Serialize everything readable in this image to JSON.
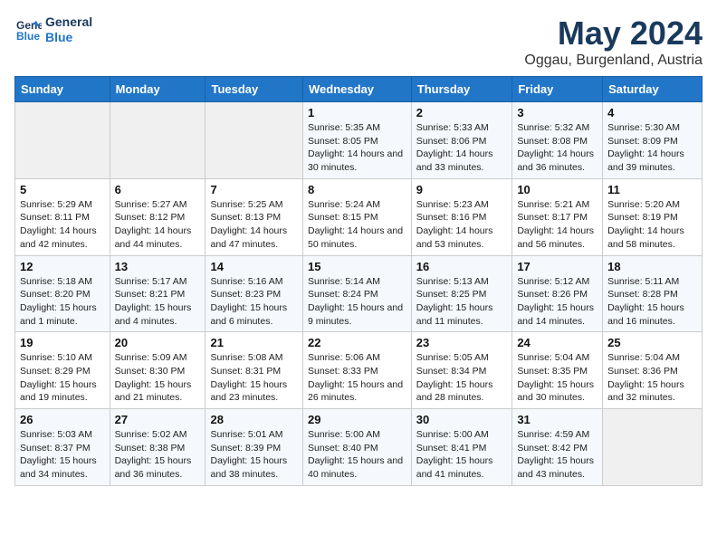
{
  "header": {
    "logo_line1": "General",
    "logo_line2": "Blue",
    "title": "May 2024",
    "subtitle": "Oggau, Burgenland, Austria"
  },
  "weekdays": [
    "Sunday",
    "Monday",
    "Tuesday",
    "Wednesday",
    "Thursday",
    "Friday",
    "Saturday"
  ],
  "weeks": [
    [
      {
        "day": "",
        "sunrise": "",
        "sunset": "",
        "daylight": ""
      },
      {
        "day": "",
        "sunrise": "",
        "sunset": "",
        "daylight": ""
      },
      {
        "day": "",
        "sunrise": "",
        "sunset": "",
        "daylight": ""
      },
      {
        "day": "1",
        "sunrise": "Sunrise: 5:35 AM",
        "sunset": "Sunset: 8:05 PM",
        "daylight": "Daylight: 14 hours and 30 minutes."
      },
      {
        "day": "2",
        "sunrise": "Sunrise: 5:33 AM",
        "sunset": "Sunset: 8:06 PM",
        "daylight": "Daylight: 14 hours and 33 minutes."
      },
      {
        "day": "3",
        "sunrise": "Sunrise: 5:32 AM",
        "sunset": "Sunset: 8:08 PM",
        "daylight": "Daylight: 14 hours and 36 minutes."
      },
      {
        "day": "4",
        "sunrise": "Sunrise: 5:30 AM",
        "sunset": "Sunset: 8:09 PM",
        "daylight": "Daylight: 14 hours and 39 minutes."
      }
    ],
    [
      {
        "day": "5",
        "sunrise": "Sunrise: 5:29 AM",
        "sunset": "Sunset: 8:11 PM",
        "daylight": "Daylight: 14 hours and 42 minutes."
      },
      {
        "day": "6",
        "sunrise": "Sunrise: 5:27 AM",
        "sunset": "Sunset: 8:12 PM",
        "daylight": "Daylight: 14 hours and 44 minutes."
      },
      {
        "day": "7",
        "sunrise": "Sunrise: 5:25 AM",
        "sunset": "Sunset: 8:13 PM",
        "daylight": "Daylight: 14 hours and 47 minutes."
      },
      {
        "day": "8",
        "sunrise": "Sunrise: 5:24 AM",
        "sunset": "Sunset: 8:15 PM",
        "daylight": "Daylight: 14 hours and 50 minutes."
      },
      {
        "day": "9",
        "sunrise": "Sunrise: 5:23 AM",
        "sunset": "Sunset: 8:16 PM",
        "daylight": "Daylight: 14 hours and 53 minutes."
      },
      {
        "day": "10",
        "sunrise": "Sunrise: 5:21 AM",
        "sunset": "Sunset: 8:17 PM",
        "daylight": "Daylight: 14 hours and 56 minutes."
      },
      {
        "day": "11",
        "sunrise": "Sunrise: 5:20 AM",
        "sunset": "Sunset: 8:19 PM",
        "daylight": "Daylight: 14 hours and 58 minutes."
      }
    ],
    [
      {
        "day": "12",
        "sunrise": "Sunrise: 5:18 AM",
        "sunset": "Sunset: 8:20 PM",
        "daylight": "Daylight: 15 hours and 1 minute."
      },
      {
        "day": "13",
        "sunrise": "Sunrise: 5:17 AM",
        "sunset": "Sunset: 8:21 PM",
        "daylight": "Daylight: 15 hours and 4 minutes."
      },
      {
        "day": "14",
        "sunrise": "Sunrise: 5:16 AM",
        "sunset": "Sunset: 8:23 PM",
        "daylight": "Daylight: 15 hours and 6 minutes."
      },
      {
        "day": "15",
        "sunrise": "Sunrise: 5:14 AM",
        "sunset": "Sunset: 8:24 PM",
        "daylight": "Daylight: 15 hours and 9 minutes."
      },
      {
        "day": "16",
        "sunrise": "Sunrise: 5:13 AM",
        "sunset": "Sunset: 8:25 PM",
        "daylight": "Daylight: 15 hours and 11 minutes."
      },
      {
        "day": "17",
        "sunrise": "Sunrise: 5:12 AM",
        "sunset": "Sunset: 8:26 PM",
        "daylight": "Daylight: 15 hours and 14 minutes."
      },
      {
        "day": "18",
        "sunrise": "Sunrise: 5:11 AM",
        "sunset": "Sunset: 8:28 PM",
        "daylight": "Daylight: 15 hours and 16 minutes."
      }
    ],
    [
      {
        "day": "19",
        "sunrise": "Sunrise: 5:10 AM",
        "sunset": "Sunset: 8:29 PM",
        "daylight": "Daylight: 15 hours and 19 minutes."
      },
      {
        "day": "20",
        "sunrise": "Sunrise: 5:09 AM",
        "sunset": "Sunset: 8:30 PM",
        "daylight": "Daylight: 15 hours and 21 minutes."
      },
      {
        "day": "21",
        "sunrise": "Sunrise: 5:08 AM",
        "sunset": "Sunset: 8:31 PM",
        "daylight": "Daylight: 15 hours and 23 minutes."
      },
      {
        "day": "22",
        "sunrise": "Sunrise: 5:06 AM",
        "sunset": "Sunset: 8:33 PM",
        "daylight": "Daylight: 15 hours and 26 minutes."
      },
      {
        "day": "23",
        "sunrise": "Sunrise: 5:05 AM",
        "sunset": "Sunset: 8:34 PM",
        "daylight": "Daylight: 15 hours and 28 minutes."
      },
      {
        "day": "24",
        "sunrise": "Sunrise: 5:04 AM",
        "sunset": "Sunset: 8:35 PM",
        "daylight": "Daylight: 15 hours and 30 minutes."
      },
      {
        "day": "25",
        "sunrise": "Sunrise: 5:04 AM",
        "sunset": "Sunset: 8:36 PM",
        "daylight": "Daylight: 15 hours and 32 minutes."
      }
    ],
    [
      {
        "day": "26",
        "sunrise": "Sunrise: 5:03 AM",
        "sunset": "Sunset: 8:37 PM",
        "daylight": "Daylight: 15 hours and 34 minutes."
      },
      {
        "day": "27",
        "sunrise": "Sunrise: 5:02 AM",
        "sunset": "Sunset: 8:38 PM",
        "daylight": "Daylight: 15 hours and 36 minutes."
      },
      {
        "day": "28",
        "sunrise": "Sunrise: 5:01 AM",
        "sunset": "Sunset: 8:39 PM",
        "daylight": "Daylight: 15 hours and 38 minutes."
      },
      {
        "day": "29",
        "sunrise": "Sunrise: 5:00 AM",
        "sunset": "Sunset: 8:40 PM",
        "daylight": "Daylight: 15 hours and 40 minutes."
      },
      {
        "day": "30",
        "sunrise": "Sunrise: 5:00 AM",
        "sunset": "Sunset: 8:41 PM",
        "daylight": "Daylight: 15 hours and 41 minutes."
      },
      {
        "day": "31",
        "sunrise": "Sunrise: 4:59 AM",
        "sunset": "Sunset: 8:42 PM",
        "daylight": "Daylight: 15 hours and 43 minutes."
      },
      {
        "day": "",
        "sunrise": "",
        "sunset": "",
        "daylight": ""
      }
    ]
  ]
}
